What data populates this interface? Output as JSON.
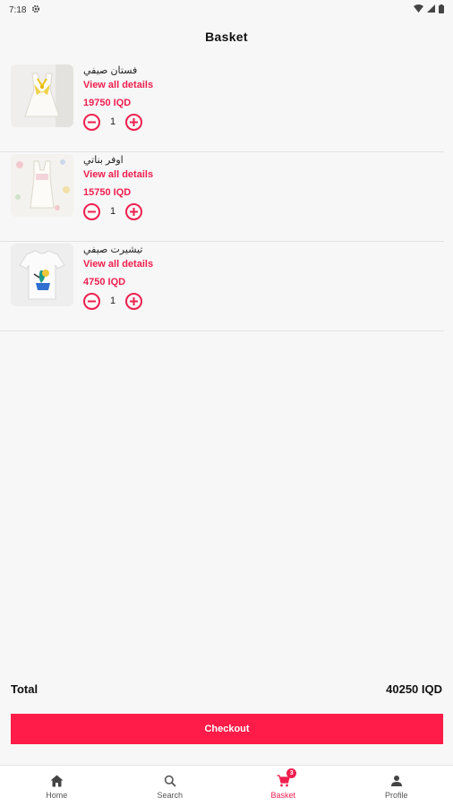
{
  "status_bar": {
    "time": "7:18"
  },
  "header": {
    "title": "Basket"
  },
  "items": [
    {
      "name": "فستان صيفي",
      "link_label": "View all details",
      "price": "19750 IQD",
      "quantity": "1",
      "decrease": "−",
      "increase": "+"
    },
    {
      "name": "اوفر بناتي",
      "link_label": "View all details",
      "price": "15750 IQD",
      "quantity": "1",
      "decrease": "−",
      "increase": "+"
    },
    {
      "name": "تيشيرت صيفي",
      "link_label": "View all details",
      "price": "4750 IQD",
      "quantity": "1",
      "decrease": "−",
      "increase": "+"
    }
  ],
  "summary": {
    "total_label": "Total",
    "total_value": "40250 IQD"
  },
  "checkout": {
    "label": "Checkout"
  },
  "nav": {
    "items": [
      {
        "label": "Home",
        "icon": "home-icon"
      },
      {
        "label": "Search",
        "icon": "search-icon"
      },
      {
        "label": "Basket",
        "icon": "cart-icon",
        "badge": "3"
      },
      {
        "label": "Profile",
        "icon": "person-icon"
      }
    ],
    "active": "Basket"
  },
  "colors": {
    "accent": "#ef1f4f",
    "checkout": "#ff1c48",
    "background": "#f7f7f7"
  }
}
